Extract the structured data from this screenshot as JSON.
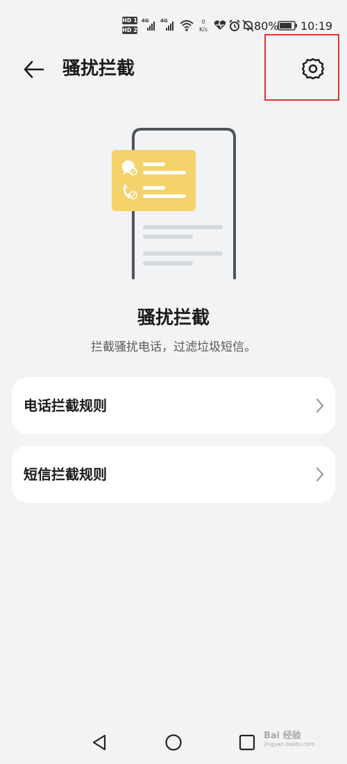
{
  "status_bar": {
    "sim_badges": [
      "HD 1",
      "HD 2"
    ],
    "network_1": "4G",
    "network_2": "4G",
    "speed_value": "0",
    "speed_unit": "K/s",
    "battery": "80%",
    "time": "10:19",
    "icons": [
      "wifi-icon",
      "heart-icon",
      "alarm-icon",
      "mute-bell-icon",
      "battery-icon"
    ]
  },
  "header": {
    "title": "骚扰拦截",
    "back_icon": "arrow-left-icon",
    "settings_icon": "gear-icon"
  },
  "hero": {
    "title": "骚扰拦截",
    "subtitle": "拦截骚扰电话，过滤垃圾短信。",
    "illustration_icons": [
      "message-blocked-icon",
      "phone-blocked-icon"
    ]
  },
  "menu": {
    "items": [
      {
        "label": "电话拦截规则"
      },
      {
        "label": "短信拦截规则"
      }
    ]
  },
  "nav_bar": {
    "icons": [
      "back-triangle-icon",
      "home-circle-icon",
      "recents-square-icon"
    ]
  },
  "watermark": {
    "text": "Bai 经验",
    "url": "jingyan.baidu.com"
  },
  "colors": {
    "background": "#f1f3f5",
    "card": "#ffffff",
    "accent_yellow": "#f5d36b",
    "highlight_red": "#e8302a"
  }
}
